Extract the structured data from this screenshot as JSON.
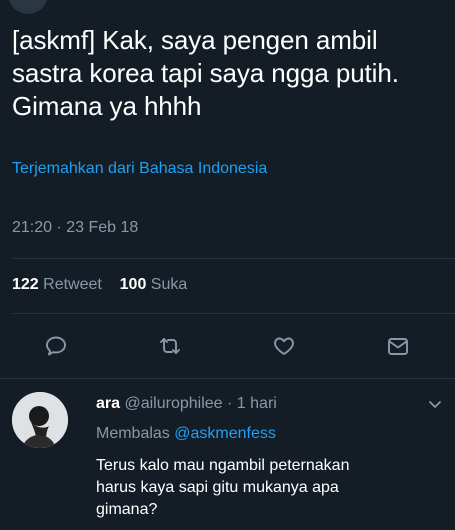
{
  "tweet": {
    "text": "[askmf] Kak, saya pengen ambil\nsastra korea tapi saya ngga putih.\nGimana ya hhhh",
    "translate_label": "Terjemahkan dari Bahasa Indonesia",
    "timestamp": "21:20 · 23 Feb 18",
    "retweet_count": "122",
    "retweet_label": "Retweet",
    "like_count": "100",
    "like_label": "Suka"
  },
  "actions": {
    "reply_icon": "reply-icon",
    "retweet_icon": "retweet-icon",
    "like_icon": "heart-icon",
    "dm_icon": "envelope-icon"
  },
  "reply": {
    "name": "ara",
    "handle": "@ailurophilee",
    "separator": "·",
    "time": "1 hari",
    "replying_label": "Membalas",
    "replying_handle": "@askmenfess",
    "text": "Terus kalo mau ngambil peternakan\nharus kaya sapi gitu mukanya apa\ngimana?"
  },
  "colors": {
    "background": "#141d26",
    "link": "#1da1f2",
    "muted": "#8899a6",
    "text": "#ffffff"
  }
}
